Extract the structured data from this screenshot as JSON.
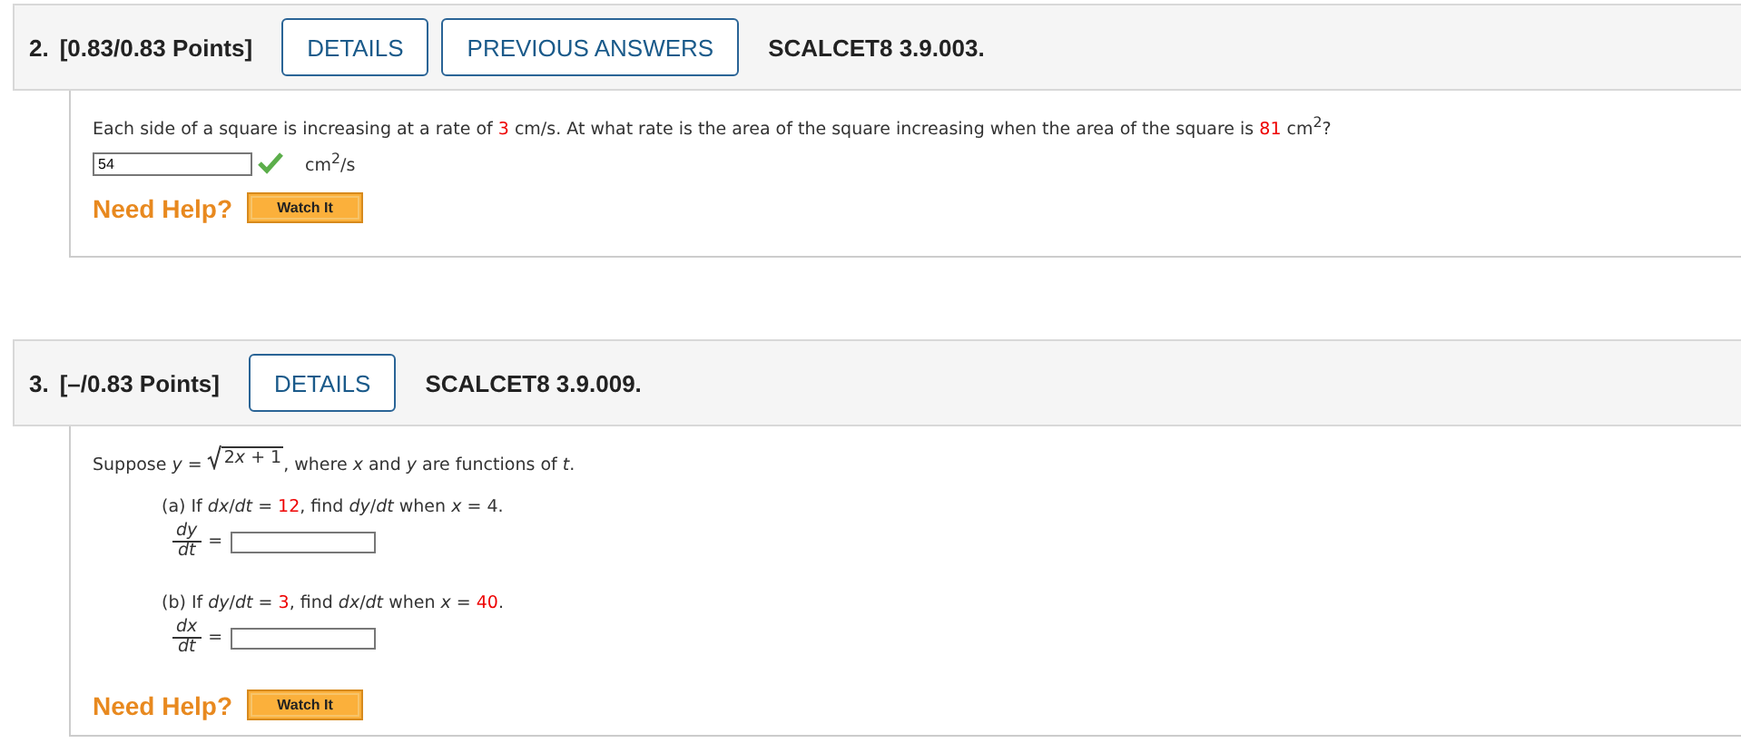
{
  "questions": [
    {
      "number": "2.",
      "points": "[0.83/0.83 Points]",
      "buttons": [
        "DETAILS",
        "PREVIOUS ANSWERS"
      ],
      "code": "SCALCET8 3.9.003.",
      "prompt": [
        {
          "kind": "plain",
          "text": "Each side of a square is increasing at a rate of "
        },
        {
          "kind": "given",
          "text": "3"
        },
        {
          "kind": "plain",
          "text": " cm/s. At what rate is the area of the square increasing when the area of the square is "
        },
        {
          "kind": "given",
          "text": "81"
        },
        {
          "kind": "plain",
          "text": " cm$^{2}$?"
        }
      ],
      "parts": [
        {
          "kind": "inline",
          "value": "54",
          "correct": true,
          "unit": "cm$^{2}$/s"
        }
      ],
      "help": "Need Help?",
      "help_button": "Watch It"
    },
    {
      "number": "3.",
      "points": "[–/0.83 Points]",
      "buttons": [
        "DETAILS"
      ],
      "code": "SCALCET8 3.9.009.",
      "prompt": [
        {
          "kind": "plain",
          "text": "Suppose  *y* = "
        },
        {
          "kind": "sqrt",
          "radicand": [
            {
              "kind": "plain",
              "text": "2"
            },
            {
              "kind": "var",
              "text": "x"
            },
            {
              "kind": "plain",
              "text": " + 1"
            }
          ]
        },
        {
          "kind": "plain",
          "text": ",  where *x* and *y* are functions of *t*."
        }
      ],
      "parts": [
        {
          "kind": "fraction",
          "question": [
            {
              "kind": "plain",
              "text": "(a) If  *dx*/*dt* = "
            },
            {
              "kind": "given",
              "text": "12"
            },
            {
              "kind": "plain",
              "text": ",  find  *dy*/*dt*  when  *x* = 4."
            }
          ],
          "numerator": "dy",
          "denominator": "dt",
          "equals": "="
        },
        {
          "kind": "fraction",
          "question": [
            {
              "kind": "plain",
              "text": "(b) If  *dy*/*dt* = "
            },
            {
              "kind": "given",
              "text": "3"
            },
            {
              "kind": "plain",
              "text": ",  find  *dx*/*dt*  when  *x* = "
            },
            {
              "kind": "given",
              "text": "40"
            },
            {
              "kind": "plain",
              "text": "."
            }
          ],
          "numerator": "dx",
          "denominator": "dt",
          "equals": "="
        }
      ],
      "help": "Need Help?",
      "help_button": "Watch It"
    }
  ]
}
